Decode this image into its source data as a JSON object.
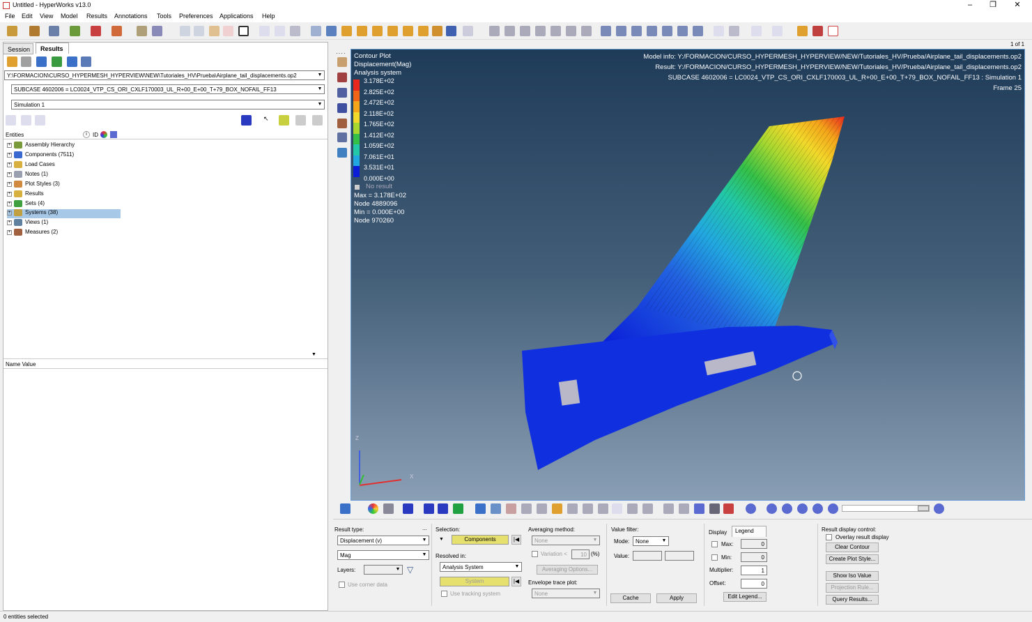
{
  "window": {
    "title": "Untitled - HyperWorks v13.0",
    "min": "–",
    "max": "❐",
    "close": "✕"
  },
  "menu": [
    "File",
    "Edit",
    "View",
    "Model",
    "Results",
    "Annotations",
    "Tools",
    "Preferences",
    "Applications",
    "Help"
  ],
  "tabs": {
    "session": "Session",
    "results": "Results"
  },
  "page_indicator": "1 of 1",
  "left": {
    "file_path": "Y:\\FORMACION\\CURSO_HYPERMESH_HYPERVIEW\\NEW\\Tutoriales_HV\\Prueba\\Airplane_tail_displacements.op2",
    "subcase": "SUBCASE 4602006 = LC0024_VTP_CS_ORI_CXLF170003_UL_R+00_E+00_T+79_BOX_NOFAIL_FF13",
    "simulation": "Simulation 1",
    "entities_header": "Entities",
    "id_header": "ID",
    "entities": [
      {
        "label": "Assembly Hierarchy",
        "color": "#7a9a3a"
      },
      {
        "label": "Components (7511)",
        "color": "#3a6ad0"
      },
      {
        "label": "Load Cases",
        "color": "#d8b040"
      },
      {
        "label": "Notes (1)",
        "color": "#9aa0b0"
      },
      {
        "label": "Plot Styles (3)",
        "color": "#d08a40"
      },
      {
        "label": "Results",
        "color": "#d8b040"
      },
      {
        "label": "Sets  (4)",
        "color": "#40a040"
      },
      {
        "label": "Systems (38)",
        "color": "#c0a040"
      },
      {
        "label": "Views (1)",
        "color": "#6080a0"
      },
      {
        "label": "Measures (2)",
        "color": "#a06040"
      }
    ],
    "name_value_header": "Name Value"
  },
  "viewport": {
    "plot_title": "Contour Plot",
    "result_name": "Displacement(Mag)",
    "system": "Analysis system",
    "legend_values": [
      "3.178E+02",
      "2.825E+02",
      "2.472E+02",
      "2.118E+02",
      "1.765E+02",
      "1.412E+02",
      "1.059E+02",
      "7.061E+01",
      "3.531E+01",
      "0.000E+00"
    ],
    "legend_colors": [
      "#e8281e",
      "#f06418",
      "#f4a51a",
      "#f2d82a",
      "#a8d830",
      "#34c048",
      "#22c8a8",
      "#22a8e0",
      "#2262e0",
      "#0a1ed8"
    ],
    "no_result": "No result",
    "max_text": "Max = 3.178E+02",
    "max_node": "Node 4889096",
    "min_text": "Min = 0.000E+00",
    "min_node": "Node 970260",
    "model_info": "Model info:  Y:/FORMACION/CURSO_HYPERMESH_HYPERVIEW/NEW/Tutoriales_HV/Prueba/Airplane_tail_displacements.op2",
    "result_info": "Result:  Y:/FORMACION/CURSO_HYPERMESH_HYPERVIEW/NEW/Tutoriales_HV/Prueba/Airplane_tail_displacements.op2",
    "subcase_info": "SUBCASE 4602006 = LC0024_VTP_CS_ORI_CXLF170003_UL_R+00_E+00_T+79_BOX_NOFAIL_FF13  :  Simulation 1",
    "frame": "Frame 25",
    "axis_z": "Z",
    "axis_x": "X"
  },
  "panel": {
    "result_type_label": "Result type:",
    "result_type_value": "Displacement (v)",
    "component_value": "Mag",
    "layers_label": "Layers:",
    "use_corner_data": "Use corner data",
    "selection_label": "Selection:",
    "components_btn": "Components",
    "resolved_in_label": "Resolved in:",
    "resolved_in_value": "Analysis System",
    "system_btn": "System",
    "use_tracking": "Use tracking system",
    "averaging_label": "Averaging method:",
    "averaging_value": "None",
    "variation_label": "Variation <",
    "variation_value": "10",
    "variation_unit": "(%)",
    "averaging_options": "Averaging Options...",
    "envelope_label": "Envelope trace plot:",
    "envelope_value": "None",
    "value_filter_label": "Value filter:",
    "mode_label": "Mode:",
    "mode_value": "None",
    "value_label": "Value:",
    "cache_btn": "Cache",
    "apply_btn": "Apply",
    "display_tab": "Display",
    "legend_tab": "Legend",
    "max_label": "Max:",
    "max_value": "0",
    "min_label": "Min:",
    "min_value": "0",
    "multiplier_label": "Multiplier:",
    "multiplier_value": "1",
    "offset_label": "Offset:",
    "offset_value": "0",
    "edit_legend_btn": "Edit Legend...",
    "rdc_label": "Result display control:",
    "overlay_label": "Overlay result display",
    "clear_contour_btn": "Clear Contour",
    "create_plot_style_btn": "Create Plot Style...",
    "show_iso_btn": "Show Iso Value",
    "projection_rule_btn": "Projection Rule...",
    "query_results_btn": "Query Results..."
  },
  "status": "0 entities selected"
}
